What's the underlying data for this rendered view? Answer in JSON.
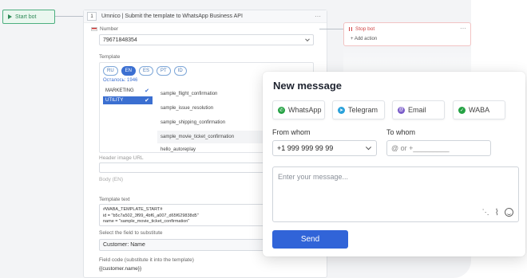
{
  "canvas": {
    "start_bot_label": "Start bot"
  },
  "node": {
    "number": "1",
    "title": "Umnico | Submit the template to WhatsApp Business API",
    "number_label": "Number",
    "number_value": "79671848354",
    "template_label": "Template",
    "languages": [
      "RU",
      "EN",
      "ES",
      "PT",
      "ID"
    ],
    "active_language": "EN",
    "remaining": "Осталось: 1946",
    "categories": [
      {
        "label": "MARKETING",
        "active": false
      },
      {
        "label": "UTILITY",
        "active": true
      }
    ],
    "templates": [
      "sample_flight_confirmation",
      "sample_issue_resolution",
      "sample_shipping_confirmation",
      "sample_movie_ticket_confirmation",
      "hello_autoreplay"
    ],
    "highlighted_template": "sample_movie_ticket_confirmation",
    "header_image_label": "Header image URL",
    "body_label": "Body (EN)",
    "template_text_label": "Template text",
    "template_text_lines": [
      "#WABA_TEMPLATE_START#",
      "id = \"b5c7a502_3f99_4bf6_a007_d65f629838d5\"",
      "name = \"sample_movie_ticket_confirmation\""
    ],
    "substitute_label": "Select the field to substitute",
    "substitute_value": "Customer: Name",
    "field_code_label": "Field code (substitute it into the template)",
    "field_code_value": "{{customer.name}}"
  },
  "stop_node": {
    "title": "Stop bot",
    "add_action": "Add action"
  },
  "dialog": {
    "title": "New message",
    "channels": [
      {
        "label": "WhatsApp",
        "icon": "whatsapp-icon",
        "color": "#25a244"
      },
      {
        "label": "Telegram",
        "icon": "telegram-icon",
        "color": "#2aa1da"
      },
      {
        "label": "Email",
        "icon": "email-icon",
        "color": "#7a5cc9"
      },
      {
        "label": "WABA",
        "icon": "waba-icon",
        "color": "#25a244"
      }
    ],
    "from_label": "From whom",
    "from_value": "+1 999 999 99 99",
    "to_label": "To whom",
    "to_placeholder": "@ or +_________",
    "message_placeholder": "Enter your message...",
    "send_label": "Send"
  }
}
